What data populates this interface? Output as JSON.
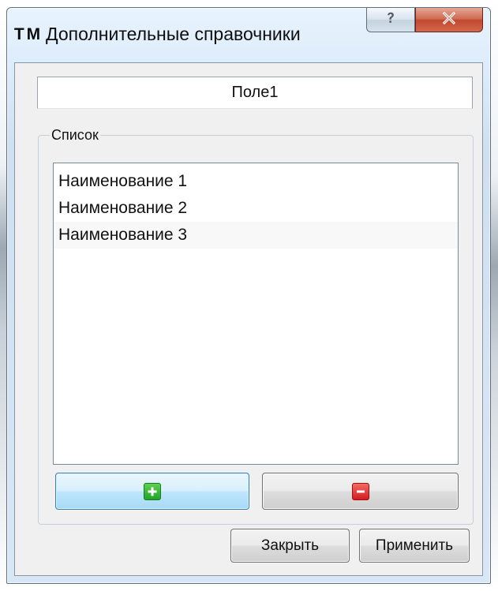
{
  "window": {
    "title": "Дополнительные справочники",
    "app_logo": {
      "left": "T",
      "right": "M"
    },
    "controls": {
      "help_icon": "help-icon",
      "close_icon": "close-icon"
    }
  },
  "field": {
    "header_label": "Поле1"
  },
  "list_group": {
    "title": "Список",
    "items": [
      {
        "label": "Наименование 1"
      },
      {
        "label": "Наименование 2"
      },
      {
        "label": "Наименование 3"
      }
    ],
    "add_button_icon": "plus-icon",
    "remove_button_icon": "minus-icon"
  },
  "footer": {
    "close_label": "Закрыть",
    "apply_label": "Применить"
  },
  "colors": {
    "title_gradient_top": "#e8f3fd",
    "title_gradient_bottom": "#d8e7f6",
    "client_background": "#f0f0f0",
    "primary_button": "#bee6fd",
    "close_button_red": "#c2472d",
    "plus_green": "#20a32a",
    "minus_red": "#d41c1f"
  }
}
